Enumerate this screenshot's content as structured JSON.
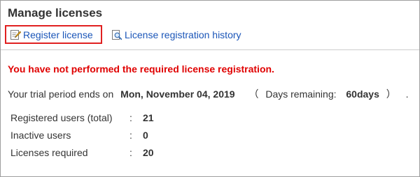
{
  "page": {
    "title": "Manage licenses"
  },
  "toolbar": {
    "register_label": "Register license",
    "register_icon": "edit-document-icon",
    "history_label": "License registration history",
    "history_icon": "magnifier-document-icon"
  },
  "warning": {
    "text": "You have not performed the required license registration."
  },
  "trial": {
    "prefix": "Your trial period ends on",
    "end_date": "Mon, November 04, 2019",
    "open_paren": "（",
    "days_label": "Days remaining:",
    "days_value": "60days",
    "close_paren": "）",
    "period": "."
  },
  "stats": [
    {
      "label": "Registered users (total)",
      "colon": ":",
      "value": "21"
    },
    {
      "label": "Inactive users",
      "colon": ":",
      "value": "0"
    },
    {
      "label": "Licenses required",
      "colon": ":",
      "value": "20"
    }
  ],
  "colors": {
    "warning": "#e00000",
    "link": "#1a55b8",
    "highlight_border": "#e02020"
  }
}
